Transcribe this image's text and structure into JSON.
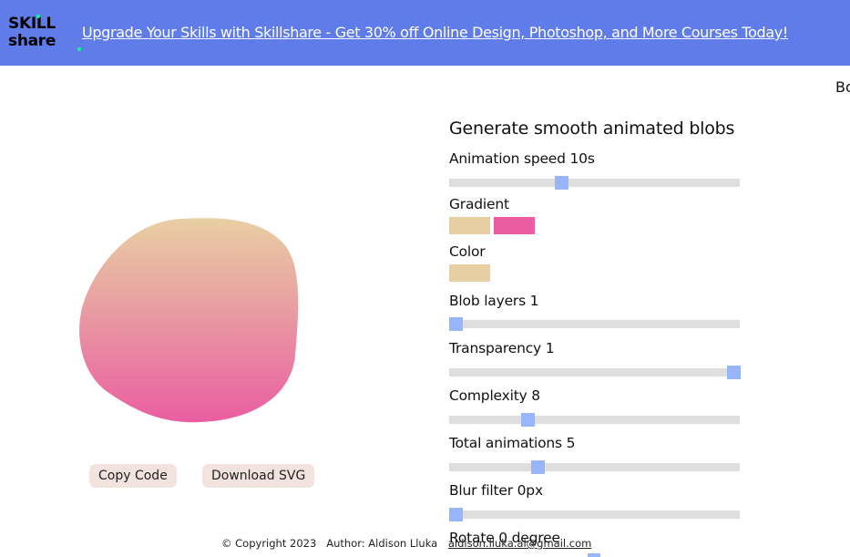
{
  "banner": {
    "logo_line1": "SKILL",
    "logo_line2": "share",
    "link_text": "Upgrade Your Skills with Skillshare - Get 30% off Online Design, Photoshop, and More Courses Today!",
    "background": "#5f7ce8"
  },
  "edge_text": "Bo",
  "blob": {
    "gradient_top": "#e8cfa3",
    "gradient_bottom": "#ea5ea1"
  },
  "buttons": {
    "copy_code": "Copy Code",
    "download_svg": "Download SVG"
  },
  "panel": {
    "title": "Generate smooth animated blobs",
    "animation_speed": {
      "label": "Animation speed 10s",
      "value": 0.38
    },
    "gradient": {
      "label": "Gradient",
      "colors": [
        "#e8cfa3",
        "#ea5ea1"
      ]
    },
    "color": {
      "label": "Color",
      "value": "#e8cfa3"
    },
    "blob_layers": {
      "label": "Blob layers 1",
      "value": 0.0
    },
    "transparency": {
      "label": "Transparency 1",
      "value": 1.0
    },
    "complexity": {
      "label": "Complexity 8",
      "value": 0.26
    },
    "total_animations": {
      "label": "Total animations 5",
      "value": 0.295
    },
    "blur_filter": {
      "label": "Blur filter 0px",
      "value": 0.0
    },
    "rotate": {
      "label": "Rotate 0 degree"
    }
  },
  "footer": {
    "copyright": "© Copyright 2023",
    "author": "Author: Aldison Lluka",
    "email": "aldison.lluka.al@gmail.com"
  },
  "colors": {
    "slider_track": "#dedede",
    "slider_thumb": "#98b5fb",
    "button_bg": "#f2e3df"
  }
}
